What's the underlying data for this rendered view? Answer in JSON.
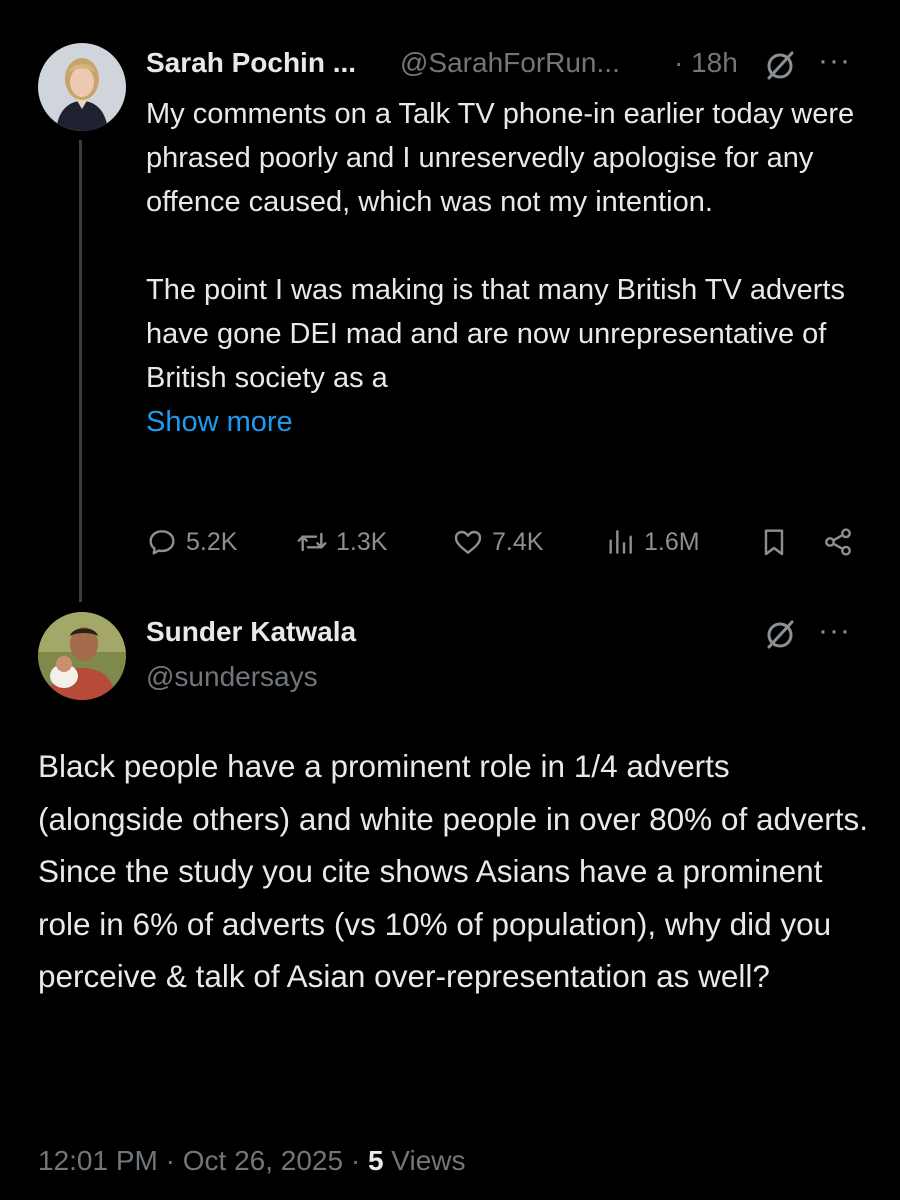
{
  "parent_tweet": {
    "display_name": "Sarah Pochin ...",
    "handle": "@SarahForRun...",
    "time": "· 18h",
    "more_label": "···",
    "paragraph1": "My comments on a Talk TV phone-in earlier today were phrased poorly and I unreservedly apologise for any offence caused, which was not my intention.",
    "paragraph2": "The point I was making is that many British TV adverts have gone DEI mad and are now unrepresentative of British society as a",
    "show_more": "Show more",
    "stats": {
      "replies": "5.2K",
      "reposts": "1.3K",
      "likes": "7.4K",
      "views": "1.6M"
    }
  },
  "reply_tweet": {
    "display_name": "Sunder Katwala",
    "handle": "@sundersays",
    "more_label": "···",
    "text": "Black people have a prominent role in 1/4 adverts (alongside others) and white people in over 80% of adverts. Since the study you cite shows Asians have a prominent role in 6% of adverts (vs 10% of population), why did you perceive & talk of Asian over-representation as well?",
    "timestamp": "12:01 PM · Oct 26, 2025 · ",
    "views_count": "5",
    "views_label": " Views"
  },
  "icons": {
    "grok": "grok-icon",
    "reply": "reply-icon",
    "repost": "repost-icon",
    "like": "heart-icon",
    "views": "views-bars-icon",
    "bookmark": "bookmark-icon",
    "share": "share-icon"
  },
  "colors": {
    "background": "#000000",
    "text": "#e7e9ea",
    "muted": "#71767b",
    "link": "#1d9bf0",
    "thread_line": "#3a3d41"
  }
}
